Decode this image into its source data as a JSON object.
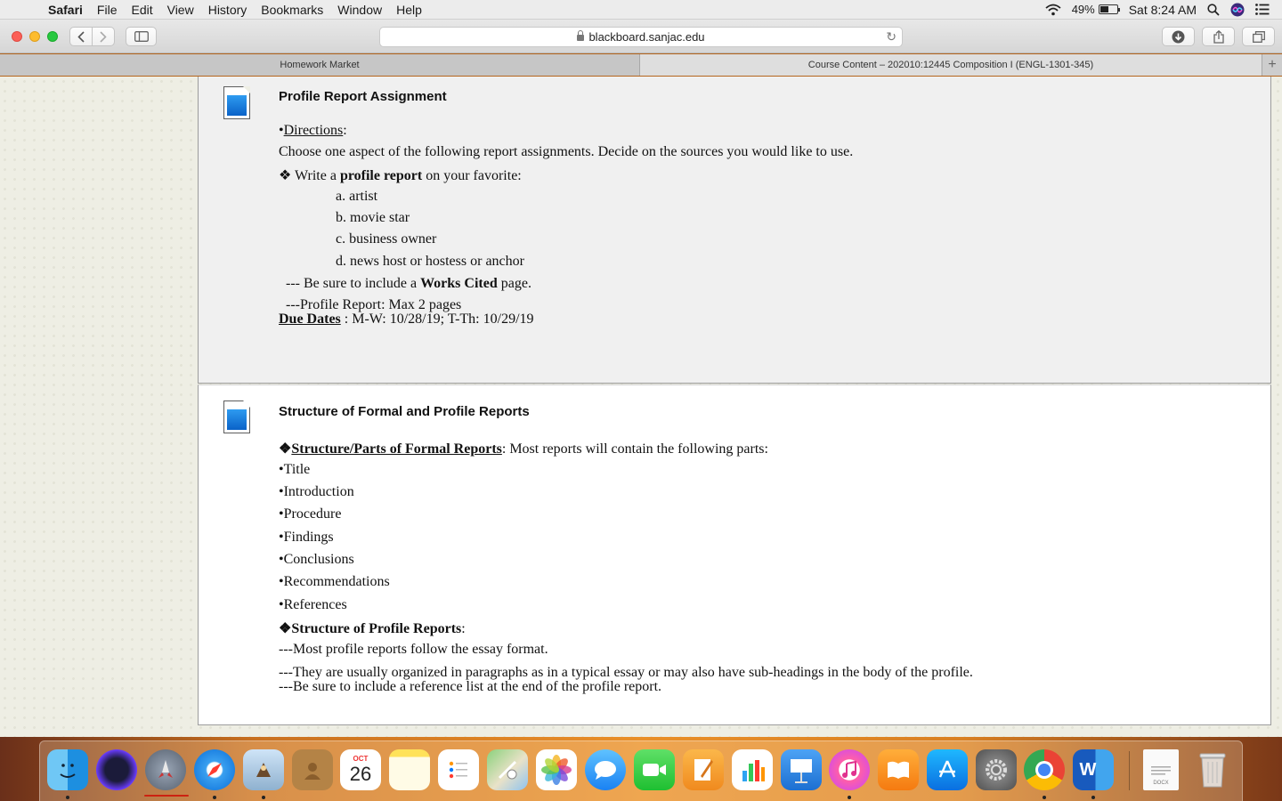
{
  "menubar": {
    "app_name": "Safari",
    "menus": [
      "File",
      "Edit",
      "View",
      "History",
      "Bookmarks",
      "Window",
      "Help"
    ],
    "battery_percent": "49%",
    "battery_level": 0.49,
    "clock": "Sat 8:24 AM"
  },
  "toolbar": {
    "url": "blackboard.sanjac.edu"
  },
  "tabs": [
    {
      "label": "Homework Market",
      "active": false
    },
    {
      "label": "Course Content – 202010:12445 Composition I (ENGL-1301-345)",
      "active": true
    }
  ],
  "items": [
    {
      "title": "Profile Report Assignment",
      "directions_label": "Directions",
      "intro": "Choose one aspect of the following report assignments. Decide on the sources you would like to use.",
      "write_prefix": "❖ Write a ",
      "write_bold": "profile report",
      "write_suffix": " on your favorite:",
      "options": [
        "a. artist",
        "b. movie star",
        "c. business owner",
        "d. news host or hostess or anchor"
      ],
      "works_prefix": "--- Be sure to include a ",
      "works_bold": "Works Cited",
      "works_suffix": " page.",
      "max_pages": "---Profile Report: Max 2 pages",
      "due_label": "Due Dates",
      "due_value": " : M-W: 10/28/19; T-Th: 10/29/19"
    },
    {
      "title": "Structure of Formal and Profile Reports",
      "formal_label": "Structure/Parts of Formal Reports",
      "formal_suffix": ": Most reports will contain the following parts:",
      "parts": [
        "•Title",
        "•Introduction",
        "•Procedure",
        "•Findings",
        "•Conclusions",
        "•Recommendations",
        "•References"
      ],
      "profile_label": "Structure of Profile Reports",
      "profile_suffix": ":",
      "notes": [
        "---Most profile reports follow the essay format.",
        "---They are usually organized in paragraphs as in a typical essay or may also have sub-headings in the body of the profile.",
        "---Be sure to include a reference list at the end of the profile report."
      ]
    }
  ],
  "dock": {
    "calendar_month": "OCT",
    "calendar_day": "26",
    "word_letter": "W",
    "pages_badge": "DOCX"
  }
}
